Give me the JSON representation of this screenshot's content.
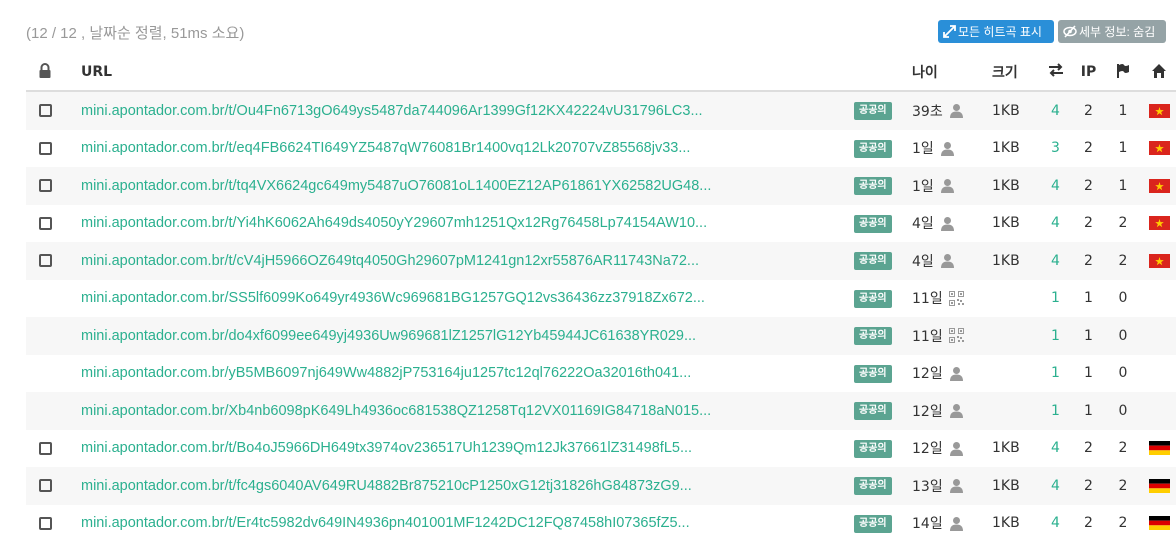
{
  "summary": "(12 / 12 , 날짜순 정렬, 51ms 소요)",
  "buttons": {
    "show_all": "모든 히트곡 표시",
    "details": "세부 정보: 숨김"
  },
  "columns": {
    "url": "URL",
    "age": "나이",
    "size": "크기",
    "ip": "IP"
  },
  "tag_label": "공공의",
  "colors": {
    "accent": "#2bb08f",
    "tag": "#5ba491",
    "primary_button": "#2a8fd8",
    "secondary_button": "#95a3a6"
  },
  "rows": [
    {
      "checkbox": true,
      "url": "mini.apontador.com.br/t/Ou4Fn6713gO649ys5487da744096Ar1399Gf12KX42224vU31796LC3...",
      "age": "39초",
      "icon": "user-icon",
      "size": "1KB",
      "hits": "4",
      "ip": "2",
      "flags": "1",
      "country": "vn"
    },
    {
      "checkbox": true,
      "url": "mini.apontador.com.br/t/eq4FB6624TI649YZ5487qW76081Br1400vq12Lk20707vZ85568jv33...",
      "age": "1일",
      "icon": "user-icon",
      "size": "1KB",
      "hits": "3",
      "ip": "2",
      "flags": "1",
      "country": "vn"
    },
    {
      "checkbox": true,
      "url": "mini.apontador.com.br/t/tq4VX6624gc649my5487uO76081oL1400EZ12AP61861YX62582UG48...",
      "age": "1일",
      "icon": "user-icon",
      "size": "1KB",
      "hits": "4",
      "ip": "2",
      "flags": "1",
      "country": "vn"
    },
    {
      "checkbox": true,
      "url": "mini.apontador.com.br/t/Yi4hK6062Ah649ds4050yY29607mh1251Qx12Rg76458Lp74154AW10...",
      "age": "4일",
      "icon": "user-icon",
      "size": "1KB",
      "hits": "4",
      "ip": "2",
      "flags": "2",
      "country": "vn"
    },
    {
      "checkbox": true,
      "url": "mini.apontador.com.br/t/cV4jH5966OZ649tq4050Gh29607pM1241gn12xr55876AR11743Na72...",
      "age": "4일",
      "icon": "user-icon",
      "size": "1KB",
      "hits": "4",
      "ip": "2",
      "flags": "2",
      "country": "vn"
    },
    {
      "checkbox": false,
      "url": "mini.apontador.com.br/SS5lf6099Ko649yr4936Wc969681BG1257GQ12vs36436zz37918Zx672...",
      "age": "11일",
      "icon": "qr-icon",
      "size": "",
      "hits": "1",
      "ip": "1",
      "flags": "0",
      "country": ""
    },
    {
      "checkbox": false,
      "url": "mini.apontador.com.br/do4xf6099ee649yj4936Uw969681lZ1257lG12Yb45944JC61638YR029...",
      "age": "11일",
      "icon": "qr-icon",
      "size": "",
      "hits": "1",
      "ip": "1",
      "flags": "0",
      "country": ""
    },
    {
      "checkbox": false,
      "url": "mini.apontador.com.br/yB5MB6097nj649Ww4882jP753164ju1257tc12ql76222Oa32016th041...",
      "age": "12일",
      "icon": "user-icon",
      "size": "",
      "hits": "1",
      "ip": "1",
      "flags": "0",
      "country": ""
    },
    {
      "checkbox": false,
      "url": "mini.apontador.com.br/Xb4nb6098pK649Lh4936oc681538QZ1258Tq12VX01169IG84718aN015...",
      "age": "12일",
      "icon": "user-icon",
      "size": "",
      "hits": "1",
      "ip": "1",
      "flags": "0",
      "country": ""
    },
    {
      "checkbox": true,
      "url": "mini.apontador.com.br/t/Bo4oJ5966DH649tx3974ov236517Uh1239Qm12Jk37661lZ31498fL5...",
      "age": "12일",
      "icon": "user-icon",
      "size": "1KB",
      "hits": "4",
      "ip": "2",
      "flags": "2",
      "country": "de"
    },
    {
      "checkbox": true,
      "url": "mini.apontador.com.br/t/fc4gs6040AV649RU4882Br875210cP1250xG12tj31826hG84873zG9...",
      "age": "13일",
      "icon": "user-icon",
      "size": "1KB",
      "hits": "4",
      "ip": "2",
      "flags": "2",
      "country": "de"
    },
    {
      "checkbox": true,
      "url": "mini.apontador.com.br/t/Er4tc5982dv649IN4936pn401001MF1242DC12FQ87458hI07365fZ5...",
      "age": "14일",
      "icon": "user-icon",
      "size": "1KB",
      "hits": "4",
      "ip": "2",
      "flags": "2",
      "country": "de"
    }
  ]
}
